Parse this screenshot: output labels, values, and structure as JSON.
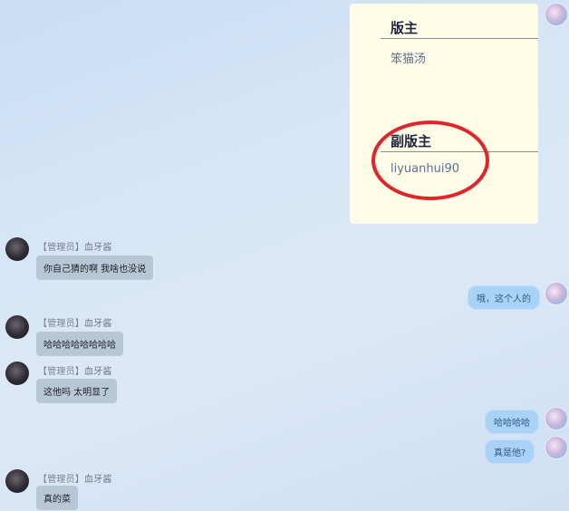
{
  "card": {
    "moderator_heading": "版主",
    "moderator_name": "笨猫汤",
    "deputy_heading": "副版主",
    "deputy_name": "liyuanhui90"
  },
  "messages": [
    {
      "side": "left",
      "role": "【管理员】",
      "name": "血牙酱",
      "text": "你自己猜的啊 我啥也没说"
    },
    {
      "side": "right",
      "text": "哦，这个人的"
    },
    {
      "side": "left",
      "role": "【管理员】",
      "name": "血牙酱",
      "text": "哈哈哈哈哈哈哈哈"
    },
    {
      "side": "left",
      "role": "【管理员】",
      "name": "血牙酱",
      "text": "这他吗 太明显了"
    },
    {
      "side": "right",
      "text": "哈哈哈哈"
    },
    {
      "side": "right",
      "text": "真是他?"
    },
    {
      "side": "left",
      "role": "【管理员】",
      "name": "血牙酱",
      "text": "真的菜"
    }
  ]
}
